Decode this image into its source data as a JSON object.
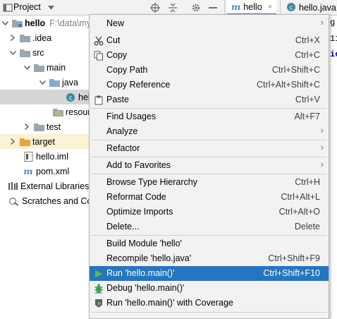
{
  "toolbar": {
    "project_label": "Project",
    "tabs": [
      {
        "label": "hello"
      },
      {
        "label": "hello.java"
      }
    ]
  },
  "tree": {
    "items": [
      {
        "label": "hello",
        "hint": "F:\\data\\my"
      },
      {
        "label": ".idea"
      },
      {
        "label": "src"
      },
      {
        "label": "main"
      },
      {
        "label": "java"
      },
      {
        "label": "hel"
      },
      {
        "label": "resour"
      },
      {
        "label": "test"
      },
      {
        "label": "target"
      },
      {
        "label": "hello.iml"
      },
      {
        "label": "pom.xml"
      },
      {
        "label": "External Libraries"
      },
      {
        "label": "Scratches and Co"
      }
    ]
  },
  "editor": {
    "fragments": [
      "g.",
      "11",
      "ic"
    ]
  },
  "menu": {
    "items": [
      {
        "label": "New",
        "submenu": true
      },
      {
        "label": "Cut",
        "shortcut": "Ctrl+X"
      },
      {
        "label": "Copy",
        "shortcut": "Ctrl+C"
      },
      {
        "label": "Copy Path",
        "shortcut": "Ctrl+Shift+C"
      },
      {
        "label": "Copy Reference",
        "shortcut": "Ctrl+Alt+Shift+C"
      },
      {
        "label": "Paste",
        "shortcut": "Ctrl+V"
      },
      {
        "label": "Find Usages",
        "shortcut": "Alt+F7"
      },
      {
        "label": "Analyze",
        "submenu": true
      },
      {
        "label": "Refactor",
        "submenu": true
      },
      {
        "label": "Add to Favorites",
        "submenu": true
      },
      {
        "label": "Browse Type Hierarchy",
        "shortcut": "Ctrl+H"
      },
      {
        "label": "Reformat Code",
        "shortcut": "Ctrl+Alt+L"
      },
      {
        "label": "Optimize Imports",
        "shortcut": "Ctrl+Alt+O"
      },
      {
        "label": "Delete...",
        "shortcut": "Delete"
      },
      {
        "label": "Build Module 'hello'"
      },
      {
        "label": "Recompile 'hello.java'",
        "shortcut": "Ctrl+Shift+F9"
      },
      {
        "label": "Run 'hello.main()'",
        "shortcut": "Ctrl+Shift+F10"
      },
      {
        "label": "Debug 'hello.main()'"
      },
      {
        "label": "Run 'hello.main()' with Coverage"
      }
    ]
  },
  "colors": {
    "highlight": "#2675bf",
    "menu_bg": "#f2f2f2",
    "folder_blue": "#87a9cf",
    "folder_orange": "#e8a33d",
    "run_green": "#499c54"
  }
}
